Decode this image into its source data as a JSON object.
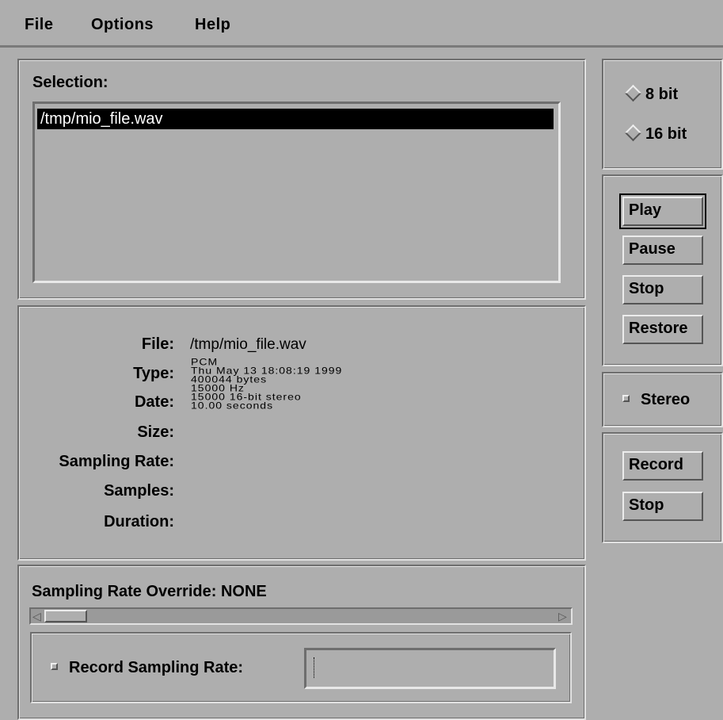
{
  "menubar": {
    "items": [
      "File",
      "Options",
      "Help"
    ]
  },
  "selection": {
    "label": "Selection:",
    "items": [
      "/tmp/mio_file.wav"
    ],
    "selected": "/tmp/mio_file.wav"
  },
  "info": {
    "labels": {
      "file": "File:",
      "type": "Type:",
      "date": "Date:",
      "size": "Size:",
      "sampling_rate": "Sampling Rate:",
      "samples": "Samples:",
      "duration": "Duration:"
    },
    "file_value": "/tmp/mio_file.wav",
    "garbled_lines": [
      "PCM",
      "Thu May 13 18:08:19 1999",
      "400044 bytes",
      "15000 Hz",
      "15000 16-bit stereo",
      "10.00 seconds"
    ]
  },
  "override": {
    "label": "Sampling Rate Override: NONE",
    "slider_value": 0,
    "record_label": "Record Sampling Rate:",
    "record_checked": false,
    "record_value": ""
  },
  "bits": {
    "options": [
      "8 bit",
      "16 bit"
    ],
    "selected": "8 bit"
  },
  "playback": {
    "play": "Play",
    "pause": "Pause",
    "stop": "Stop",
    "restore": "Restore"
  },
  "stereo": {
    "label": "Stereo",
    "checked": false
  },
  "recording": {
    "record": "Record",
    "stop": "Stop"
  }
}
